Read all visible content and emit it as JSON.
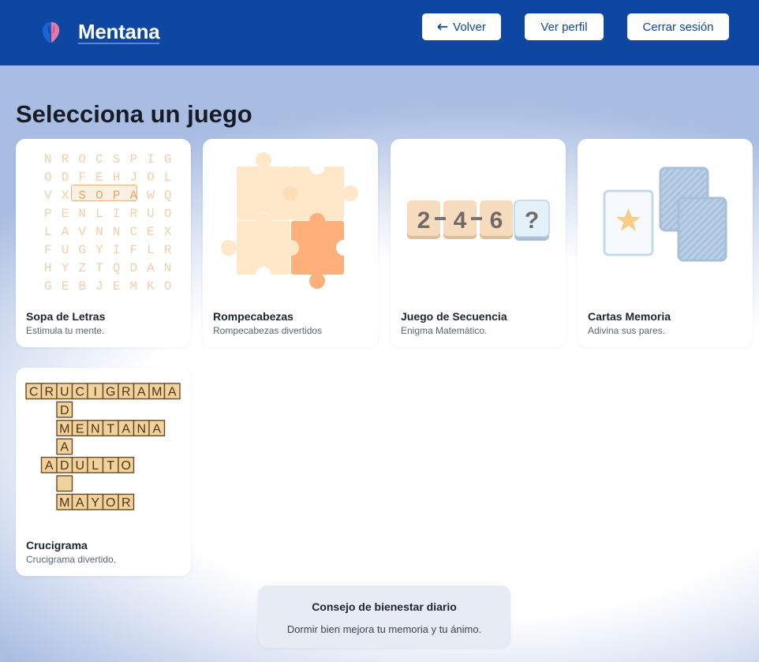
{
  "header": {
    "brand": "Mentana",
    "buttons": {
      "back": "Volver",
      "back_icon": "arrow-left-icon",
      "profile": "Ver perfil",
      "logout": "Cerrar sesión"
    }
  },
  "page": {
    "title": "Selecciona un juego"
  },
  "games": [
    {
      "title": "Sopa de Letras",
      "subtitle": "Estimula tu mente."
    },
    {
      "title": "Rompecabezas",
      "subtitle": "Rompecabezas divertidos"
    },
    {
      "title": "Juego de Secuencia",
      "subtitle": "Enigma Matemático."
    },
    {
      "title": "Cartas Memoria",
      "subtitle": "Adivina sus pares."
    },
    {
      "title": "Crucigrama",
      "subtitle": "Crucigrama divertido."
    }
  ],
  "wordsearch_grid": [
    "NROCSPIG",
    "ODFEHJOL",
    "VXSOPAWQ",
    "PENLIRUO",
    "LAVNNCEX",
    "FUGYIFLR",
    "HYZTQDAN",
    "GEBJEMKO"
  ],
  "sequence": {
    "items": [
      "2",
      "4",
      "6"
    ],
    "unknown": "?"
  },
  "crossword": {
    "crucigrama": "CRUCIGRAMA",
    "vertical": "DMAD",
    "mentana": "MENTANA",
    "adulto": "ADULTO",
    "mayor": "MAYOR"
  },
  "tip": {
    "title": "Consejo de bienestar diario",
    "message": "Dormir bien mejora tu memoria y tu ánimo."
  },
  "colors": {
    "header": "#0d47a1",
    "puzzle_light": "#ffe7c9",
    "puzzle_accent": "#ffb07a",
    "tile": "#f2d29c"
  }
}
